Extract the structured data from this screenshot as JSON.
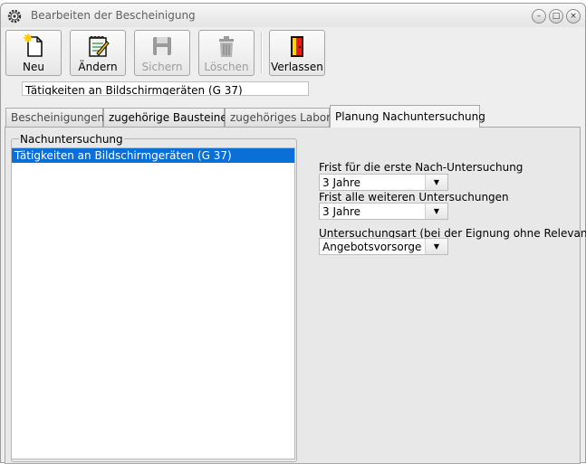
{
  "window": {
    "title": "Bearbeiten der Bescheinigung",
    "controls": [
      "–",
      "□",
      "×"
    ]
  },
  "toolbar": {
    "new_label": "Neu",
    "edit_label": "Ändern",
    "save_label": "Sichern",
    "delete_label": "Löschen",
    "exit_label": "Verlassen"
  },
  "certificate_field": {
    "value": "Tätigkeiten an Bildschirmgeräten (G 37)"
  },
  "tabs": [
    {
      "label": "Bescheinigungen"
    },
    {
      "label": "zugehörige Bausteine"
    },
    {
      "label": "zugehöriges Labor"
    },
    {
      "label": "Planung Nachuntersuchung"
    }
  ],
  "panel": {
    "group_label": "Nachuntersuchung",
    "list_items": [
      "Tätigkeiten an Bildschirmgeräten (G 37)"
    ],
    "first_deadline_label": "Frist für die erste Nach-Untersuchung",
    "first_deadline_value": "3 Jahre",
    "further_deadline_label": "Frist alle weiteren Untersuchungen",
    "further_deadline_value": "3 Jahre",
    "exam_type_label": "Untersuchungsart (bei der Eignung ohne Relevanz)",
    "exam_type_value": "Angebotsvorsorge"
  },
  "colors": {
    "selection": "#0a6fd6",
    "window_bg": "#eeeeee"
  }
}
